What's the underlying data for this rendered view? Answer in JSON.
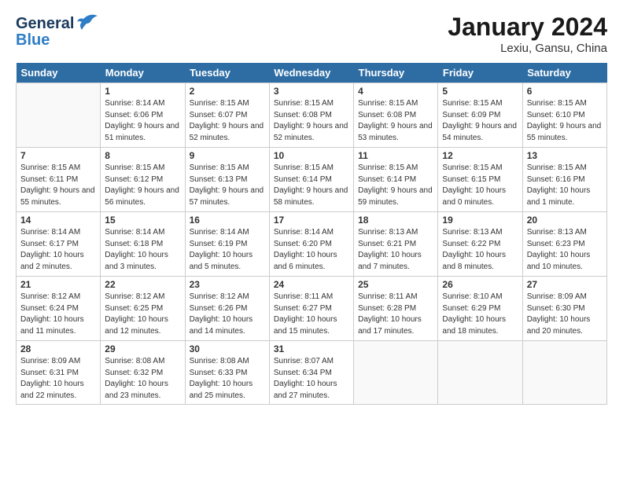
{
  "header": {
    "logo_line1": "General",
    "logo_line2": "Blue",
    "month": "January 2024",
    "location": "Lexiu, Gansu, China"
  },
  "weekdays": [
    "Sunday",
    "Monday",
    "Tuesday",
    "Wednesday",
    "Thursday",
    "Friday",
    "Saturday"
  ],
  "weeks": [
    [
      {
        "day": "",
        "empty": true
      },
      {
        "day": "1",
        "sunrise": "8:14 AM",
        "sunset": "6:06 PM",
        "daylight": "9 hours and 51 minutes."
      },
      {
        "day": "2",
        "sunrise": "8:15 AM",
        "sunset": "6:07 PM",
        "daylight": "9 hours and 52 minutes."
      },
      {
        "day": "3",
        "sunrise": "8:15 AM",
        "sunset": "6:08 PM",
        "daylight": "9 hours and 52 minutes."
      },
      {
        "day": "4",
        "sunrise": "8:15 AM",
        "sunset": "6:08 PM",
        "daylight": "9 hours and 53 minutes."
      },
      {
        "day": "5",
        "sunrise": "8:15 AM",
        "sunset": "6:09 PM",
        "daylight": "9 hours and 54 minutes."
      },
      {
        "day": "6",
        "sunrise": "8:15 AM",
        "sunset": "6:10 PM",
        "daylight": "9 hours and 55 minutes."
      }
    ],
    [
      {
        "day": "7",
        "sunrise": "8:15 AM",
        "sunset": "6:11 PM",
        "daylight": "9 hours and 55 minutes."
      },
      {
        "day": "8",
        "sunrise": "8:15 AM",
        "sunset": "6:12 PM",
        "daylight": "9 hours and 56 minutes."
      },
      {
        "day": "9",
        "sunrise": "8:15 AM",
        "sunset": "6:13 PM",
        "daylight": "9 hours and 57 minutes."
      },
      {
        "day": "10",
        "sunrise": "8:15 AM",
        "sunset": "6:14 PM",
        "daylight": "9 hours and 58 minutes."
      },
      {
        "day": "11",
        "sunrise": "8:15 AM",
        "sunset": "6:14 PM",
        "daylight": "9 hours and 59 minutes."
      },
      {
        "day": "12",
        "sunrise": "8:15 AM",
        "sunset": "6:15 PM",
        "daylight": "10 hours and 0 minutes."
      },
      {
        "day": "13",
        "sunrise": "8:15 AM",
        "sunset": "6:16 PM",
        "daylight": "10 hours and 1 minute."
      }
    ],
    [
      {
        "day": "14",
        "sunrise": "8:14 AM",
        "sunset": "6:17 PM",
        "daylight": "10 hours and 2 minutes."
      },
      {
        "day": "15",
        "sunrise": "8:14 AM",
        "sunset": "6:18 PM",
        "daylight": "10 hours and 3 minutes."
      },
      {
        "day": "16",
        "sunrise": "8:14 AM",
        "sunset": "6:19 PM",
        "daylight": "10 hours and 5 minutes."
      },
      {
        "day": "17",
        "sunrise": "8:14 AM",
        "sunset": "6:20 PM",
        "daylight": "10 hours and 6 minutes."
      },
      {
        "day": "18",
        "sunrise": "8:13 AM",
        "sunset": "6:21 PM",
        "daylight": "10 hours and 7 minutes."
      },
      {
        "day": "19",
        "sunrise": "8:13 AM",
        "sunset": "6:22 PM",
        "daylight": "10 hours and 8 minutes."
      },
      {
        "day": "20",
        "sunrise": "8:13 AM",
        "sunset": "6:23 PM",
        "daylight": "10 hours and 10 minutes."
      }
    ],
    [
      {
        "day": "21",
        "sunrise": "8:12 AM",
        "sunset": "6:24 PM",
        "daylight": "10 hours and 11 minutes."
      },
      {
        "day": "22",
        "sunrise": "8:12 AM",
        "sunset": "6:25 PM",
        "daylight": "10 hours and 12 minutes."
      },
      {
        "day": "23",
        "sunrise": "8:12 AM",
        "sunset": "6:26 PM",
        "daylight": "10 hours and 14 minutes."
      },
      {
        "day": "24",
        "sunrise": "8:11 AM",
        "sunset": "6:27 PM",
        "daylight": "10 hours and 15 minutes."
      },
      {
        "day": "25",
        "sunrise": "8:11 AM",
        "sunset": "6:28 PM",
        "daylight": "10 hours and 17 minutes."
      },
      {
        "day": "26",
        "sunrise": "8:10 AM",
        "sunset": "6:29 PM",
        "daylight": "10 hours and 18 minutes."
      },
      {
        "day": "27",
        "sunrise": "8:09 AM",
        "sunset": "6:30 PM",
        "daylight": "10 hours and 20 minutes."
      }
    ],
    [
      {
        "day": "28",
        "sunrise": "8:09 AM",
        "sunset": "6:31 PM",
        "daylight": "10 hours and 22 minutes."
      },
      {
        "day": "29",
        "sunrise": "8:08 AM",
        "sunset": "6:32 PM",
        "daylight": "10 hours and 23 minutes."
      },
      {
        "day": "30",
        "sunrise": "8:08 AM",
        "sunset": "6:33 PM",
        "daylight": "10 hours and 25 minutes."
      },
      {
        "day": "31",
        "sunrise": "8:07 AM",
        "sunset": "6:34 PM",
        "daylight": "10 hours and 27 minutes."
      },
      {
        "day": "",
        "empty": true
      },
      {
        "day": "",
        "empty": true
      },
      {
        "day": "",
        "empty": true
      }
    ]
  ]
}
